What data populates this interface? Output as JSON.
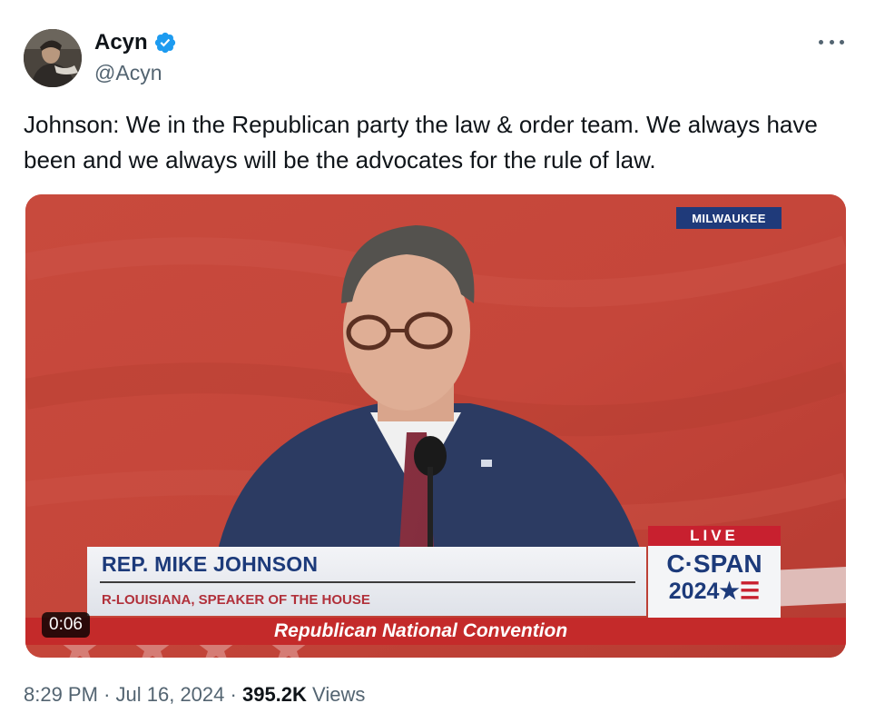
{
  "author": {
    "name": "Acyn",
    "handle": "@Acyn",
    "verified": true
  },
  "tweet": {
    "text": "Johnson: We in the Republican party the law & order team. We always have been and we always will be the advocates for the rule of law."
  },
  "media": {
    "location_badge": "MILWAUKEE",
    "lower_third_name": "REP. MIKE JOHNSON",
    "lower_third_title": "R-LOUISIANA, SPEAKER OF THE HOUSE",
    "live_label": "LIVE",
    "network": "C·SPAN",
    "network_year": "2024",
    "event_banner": "Republican National Convention",
    "duration": "0:06"
  },
  "meta": {
    "time": "8:29 PM",
    "separator": "·",
    "date": "Jul 16, 2024",
    "views_count": "395.2K",
    "views_label": "Views"
  },
  "colors": {
    "verified": "#1d9bf0",
    "secondary_text": "#536471",
    "cspan_blue": "#1c3a7a",
    "cspan_red": "#c8202f",
    "backdrop": "#c8453a"
  },
  "icons": {
    "verified": "verified-badge-icon",
    "more": "more-horizontal-icon",
    "star": "star-icon"
  }
}
